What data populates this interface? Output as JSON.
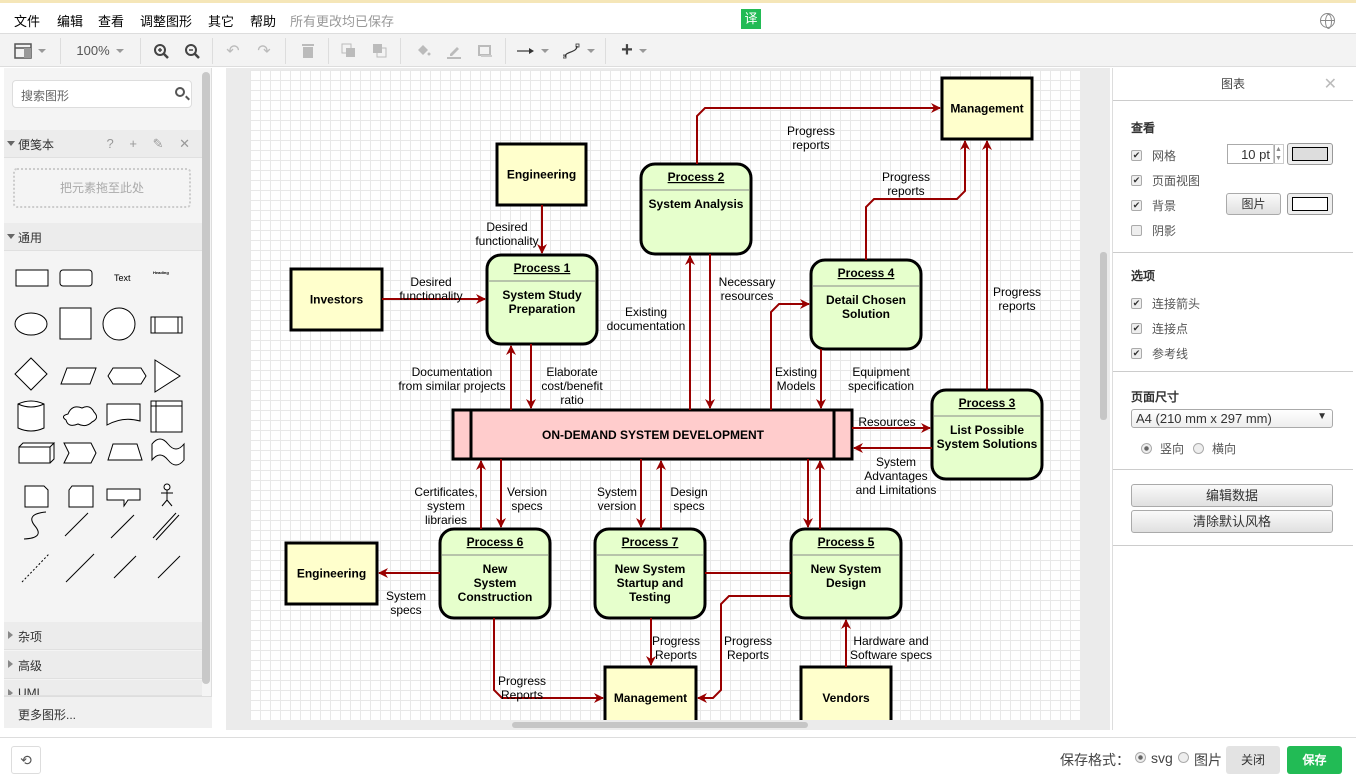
{
  "menu": {
    "items": [
      "文件",
      "编辑",
      "查看",
      "调整图形",
      "其它",
      "帮助"
    ],
    "status": "所有更改均已保存",
    "translate_label": "译"
  },
  "toolbar": {
    "zoom": "100%"
  },
  "sidebar": {
    "search_placeholder": "搜索图形",
    "scratchpad_title": "便笺本",
    "scratchpad_icons": "? + ✎ ✕",
    "dropzone_text": "把元素拖至此处",
    "general_title": "通用",
    "text_shape_label": "Text",
    "heading_shape_label": "Heading",
    "collapsed_sections": [
      "杂项",
      "高级",
      "UML"
    ],
    "more_shapes": "更多图形..."
  },
  "diagram": {
    "edge_color": "#990000",
    "external_fill": "#ffffcc",
    "process_fill": "#e6ffcc",
    "store_fill": "#ffcccc",
    "externals": [
      {
        "id": "eng1",
        "label": "Engineering"
      },
      {
        "id": "inv",
        "label": "Investors"
      },
      {
        "id": "mgmt1",
        "label": "Management"
      },
      {
        "id": "eng2",
        "label": "Engineering"
      },
      {
        "id": "mgmt2",
        "label": "Management"
      },
      {
        "id": "vendors",
        "label": "Vendors"
      }
    ],
    "processes": [
      {
        "id": "p1",
        "title": "Process 1",
        "body": [
          "System Study",
          "Preparation"
        ]
      },
      {
        "id": "p2",
        "title": "Process 2",
        "body": [
          "System Analysis"
        ]
      },
      {
        "id": "p4",
        "title": "Process 4",
        "body": [
          "Detail Chosen",
          "Solution"
        ]
      },
      {
        "id": "p3",
        "title": "Process 3",
        "body": [
          "List Possible",
          "System Solutions"
        ]
      },
      {
        "id": "p6",
        "title": "Process 6",
        "body": [
          "New",
          "System",
          "Construction"
        ]
      },
      {
        "id": "p7",
        "title": "Process 7",
        "body": [
          "New System",
          "Startup and",
          "Testing"
        ]
      },
      {
        "id": "p5",
        "title": "Process 5",
        "body": [
          "New System",
          "Design"
        ]
      }
    ],
    "store": {
      "label": "ON-DEMAND SYSTEM DEVELOPMENT"
    },
    "edge_labels": [
      {
        "id": "l1",
        "lines": [
          "Desired",
          "functionality"
        ]
      },
      {
        "id": "l2",
        "lines": [
          "Desired",
          "functionality"
        ]
      },
      {
        "id": "l3",
        "lines": [
          "Progress",
          "reports"
        ]
      },
      {
        "id": "l4",
        "lines": [
          "Progress",
          "reports"
        ]
      },
      {
        "id": "l5",
        "lines": [
          "Progress",
          "reports"
        ]
      },
      {
        "id": "l6",
        "lines": [
          "Necessary",
          "resources"
        ]
      },
      {
        "id": "l7",
        "lines": [
          "Existing",
          "documentation"
        ]
      },
      {
        "id": "l8",
        "lines": [
          "Documentation",
          "from similar projects"
        ]
      },
      {
        "id": "l9",
        "lines": [
          "Elaborate",
          "cost/benefit",
          "ratio"
        ]
      },
      {
        "id": "l10",
        "lines": [
          "Existing",
          "Models"
        ]
      },
      {
        "id": "l11",
        "lines": [
          "Equipment",
          "specification"
        ]
      },
      {
        "id": "l12",
        "lines": [
          "Resources"
        ]
      },
      {
        "id": "l13",
        "lines": [
          "System",
          "Advantages",
          "and Limitations"
        ]
      },
      {
        "id": "l14",
        "lines": [
          "Certificates,",
          "system",
          "libraries"
        ]
      },
      {
        "id": "l15",
        "lines": [
          "Version",
          "specs"
        ]
      },
      {
        "id": "l16",
        "lines": [
          "System",
          "version"
        ]
      },
      {
        "id": "l17",
        "lines": [
          "Design",
          "specs"
        ]
      },
      {
        "id": "l18",
        "lines": [
          "System",
          "specs"
        ]
      },
      {
        "id": "l19",
        "lines": [
          "Progress",
          "Reports"
        ]
      },
      {
        "id": "l20",
        "lines": [
          "Progress",
          "Reports"
        ]
      },
      {
        "id": "l21",
        "lines": [
          "Progress",
          "Reports"
        ]
      },
      {
        "id": "l22",
        "lines": [
          "Hardware and",
          "Software specs"
        ]
      }
    ]
  },
  "format_panel": {
    "title": "图表",
    "view_heading": "查看",
    "grid": {
      "label": "网格",
      "checked": true,
      "size": "10 pt"
    },
    "page_view": {
      "label": "页面视图",
      "checked": true
    },
    "background": {
      "label": "背景",
      "checked": true,
      "image_button": "图片"
    },
    "shadow": {
      "label": "阴影",
      "checked": false
    },
    "options_heading": "选项",
    "connection_arrows": {
      "label": "连接箭头",
      "checked": true
    },
    "connection_points": {
      "label": "连接点",
      "checked": true
    },
    "guides": {
      "label": "参考线",
      "checked": true
    },
    "page_size_heading": "页面尺寸",
    "page_size": "A4 (210 mm x 297 mm)",
    "portrait": {
      "label": "竖向",
      "selected": true
    },
    "landscape": {
      "label": "横向",
      "selected": false
    },
    "edit_data": "编辑数据",
    "clear_style": "清除默认风格"
  },
  "footer": {
    "format_label": "保存格式：",
    "svg_label": "svg",
    "image_label": "图片",
    "svg_selected": true,
    "close": "关闭",
    "save": "保存",
    "save_color": "#22bb55"
  }
}
